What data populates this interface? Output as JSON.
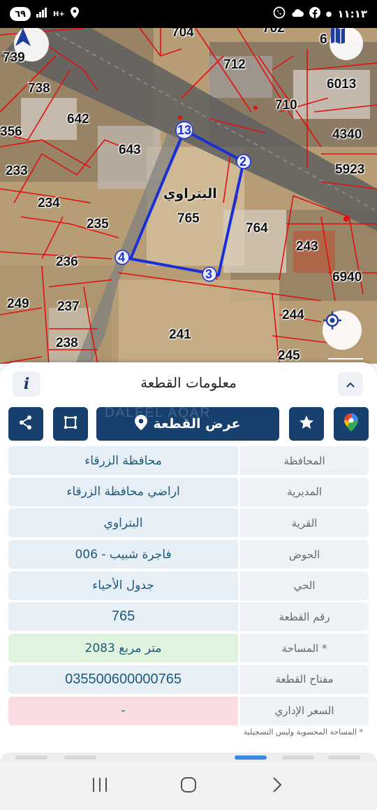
{
  "status_bar": {
    "badge": "٦٩",
    "network": "H+",
    "time": "١١:١٣"
  },
  "map": {
    "parcels": [
      {
        "id": "p704",
        "label": "704"
      },
      {
        "id": "p702",
        "label": "702"
      },
      {
        "id": "p6",
        "label": "6"
      },
      {
        "id": "p739",
        "label": "739"
      },
      {
        "id": "p712",
        "label": "712"
      },
      {
        "id": "p6013",
        "label": "6013"
      },
      {
        "id": "p738",
        "label": "738"
      },
      {
        "id": "p710",
        "label": "710"
      },
      {
        "id": "p642",
        "label": "642"
      },
      {
        "id": "p4340",
        "label": "4340"
      },
      {
        "id": "p356",
        "label": "356"
      },
      {
        "id": "p643",
        "label": "643"
      },
      {
        "id": "p233",
        "label": "233"
      },
      {
        "id": "p5923",
        "label": "5923"
      },
      {
        "id": "p234",
        "label": "234"
      },
      {
        "id": "p765",
        "label": "765"
      },
      {
        "id": "p235",
        "label": "235"
      },
      {
        "id": "p764",
        "label": "764"
      },
      {
        "id": "p243",
        "label": "243"
      },
      {
        "id": "p236",
        "label": "236"
      },
      {
        "id": "p6940",
        "label": "6940"
      },
      {
        "id": "p249",
        "label": "249"
      },
      {
        "id": "p237",
        "label": "237"
      },
      {
        "id": "p244",
        "label": "244"
      },
      {
        "id": "p241",
        "label": "241"
      },
      {
        "id": "p238",
        "label": "238"
      },
      {
        "id": "p245",
        "label": "245"
      }
    ],
    "village_label": "البتراوي",
    "corners": [
      "13",
      "2",
      "3",
      "4"
    ],
    "colors": {
      "parcel_line": "#e01010",
      "selected_outline": "#1a2fd6",
      "road": "#6a6a6a",
      "ground": "#b49a72"
    },
    "icons": {
      "compass": "north-arrow-icon",
      "layers": "layers-icon",
      "locate": "locate-icon"
    }
  },
  "sheet": {
    "title": "معلومات القطعة",
    "info_label": "i",
    "watermark": "DALEEL AQAR",
    "show_plot_button": "عرض القطعة",
    "rows": [
      {
        "label": "المحافظة",
        "value": "محافظة الزرقاء"
      },
      {
        "label": "المديرية",
        "value": "اراضي محافظة الزرقاء"
      },
      {
        "label": "القرية",
        "value": "البتراوي"
      },
      {
        "label": "الحوض",
        "value": "فاجرة شبيب - 006"
      },
      {
        "label": "الحي",
        "value": "جدول الأحياء"
      },
      {
        "label": "رقم القطعة",
        "value": "765"
      },
      {
        "label": "المساحة *",
        "value": "2083   متر مربع"
      },
      {
        "label": "مفتاح القطعة",
        "value": "035500600000765"
      },
      {
        "label": "السعر الإداري",
        "value": "-"
      }
    ],
    "footnote": "* المساحة المحسوبة وليس التسجيلية",
    "colors": {
      "primary": "#17406e",
      "area_bg": "#dff3df",
      "price_bg": "#f9dde2",
      "value_text": "#1f5a7a"
    }
  }
}
